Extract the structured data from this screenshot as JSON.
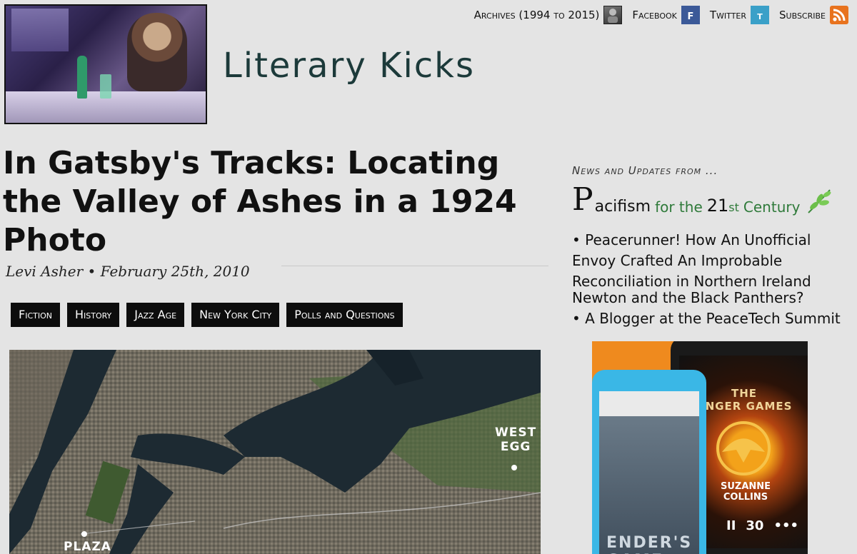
{
  "site": {
    "title": "Literary Kicks",
    "nav": [
      {
        "label": "Archives (1994 to 2015)",
        "icon": "archive-portrait-icon"
      },
      {
        "label": "Facebook",
        "icon": "facebook-icon"
      },
      {
        "label": "Twitter",
        "icon": "twitter-icon"
      },
      {
        "label": "Subscribe",
        "icon": "rss-icon"
      }
    ],
    "icon_glyphs": {
      "facebook": "f",
      "twitter": "t"
    }
  },
  "article": {
    "title": "In Gatsby's Tracks: Locating the Valley of Ashes in a 1924 Photo",
    "byline": "Levi Asher • February 25th, 2010",
    "tags": [
      "Fiction",
      "History",
      "Jazz Age",
      "New York City",
      "Polls and Questions"
    ],
    "map_labels": {
      "west_egg_1": "WEST",
      "west_egg_2": "EGG",
      "plaza": "PLAZA"
    }
  },
  "sidebar": {
    "heading": "News and Updates from ...",
    "pacifism": {
      "p": "P",
      "word": "acifism",
      "for": "for the",
      "num": "21",
      "st": "st",
      "century": "Century"
    },
    "news": [
      {
        "text": "Peacerunner! How An Unofficial Envoy Crafted An Improbable Reconciliation in Northern Ireland",
        "bullet": true
      },
      {
        "text": "Newton and the Black Panthers?",
        "bullet": false
      },
      {
        "text": "A Blogger at the PeaceTech Summit",
        "bullet": true
      }
    ],
    "ad": {
      "book1_title": "THE\nUNGER GAMES",
      "book1_author": "SUZANNE\nCOLLINS",
      "book2_text": "ENDER'S\nGAME",
      "controls": [
        "II",
        "30",
        "•••"
      ]
    }
  },
  "colors": {
    "background": "#e4e4e4",
    "tag_bg": "#0d0d0d",
    "title_teal": "#1c3a3a",
    "pacifism_green": "#2f7a3a",
    "facebook": "#3b5998",
    "twitter": "#3aa0c8",
    "rss": "#e8731e"
  }
}
